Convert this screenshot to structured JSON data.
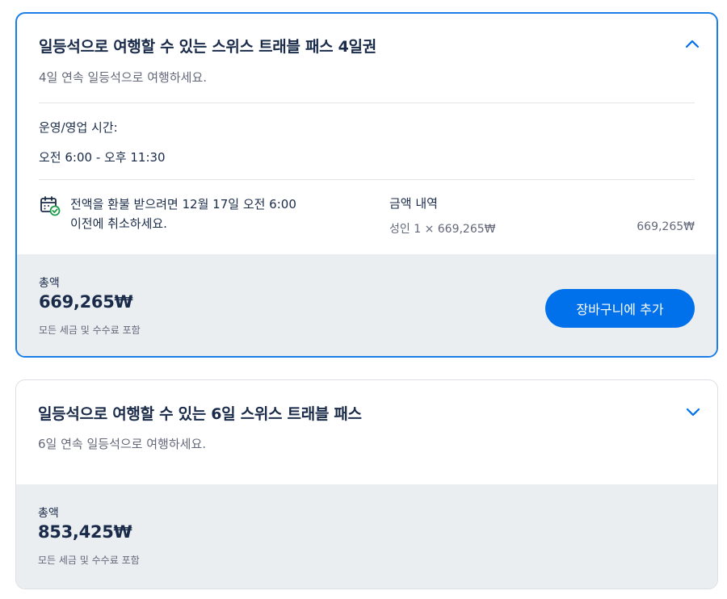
{
  "products": [
    {
      "title": "일등석으로 여행할 수 있는 스위스 트래블 패스 4일권",
      "subtitle": "4일 연속 일등석으로 여행하세요.",
      "expanded": true,
      "chevron_icon": "chevron-up-icon",
      "hours_label": "운영/영업 시간:",
      "hours_value": "오전 6:00 - 오후 11:30",
      "refund_icon": "calendar-check-icon",
      "refund_line1": "전액을 환불 받으려면 12월 17일 오전 6:00",
      "refund_line2": "이전에 취소하세요.",
      "price_breakdown_title": "금액 내역",
      "price_line_label": "성인 1 × 669,265₩",
      "price_line_amount": "669,265₩",
      "total_label": "총액",
      "total_amount": "669,265₩",
      "total_note": "모든 세금 및 수수료 포함",
      "cart_button_label": "장바구니에 추가"
    },
    {
      "title": "일등석으로 여행할 수 있는 6일 스위스 트래블 패스",
      "subtitle": "6일 연속 일등석으로 여행하세요.",
      "expanded": false,
      "chevron_icon": "chevron-down-icon",
      "total_label": "총액",
      "total_amount": "853,425₩",
      "total_note": "모든 세금 및 수수료 포함"
    }
  ],
  "colors": {
    "accent": "#0071eb",
    "selected_border": "#1a7ee6",
    "text_primary": "#1a2b49",
    "text_secondary": "#63687a",
    "total_band_bg": "#ebeef1",
    "check_green": "#1a9a4a"
  }
}
